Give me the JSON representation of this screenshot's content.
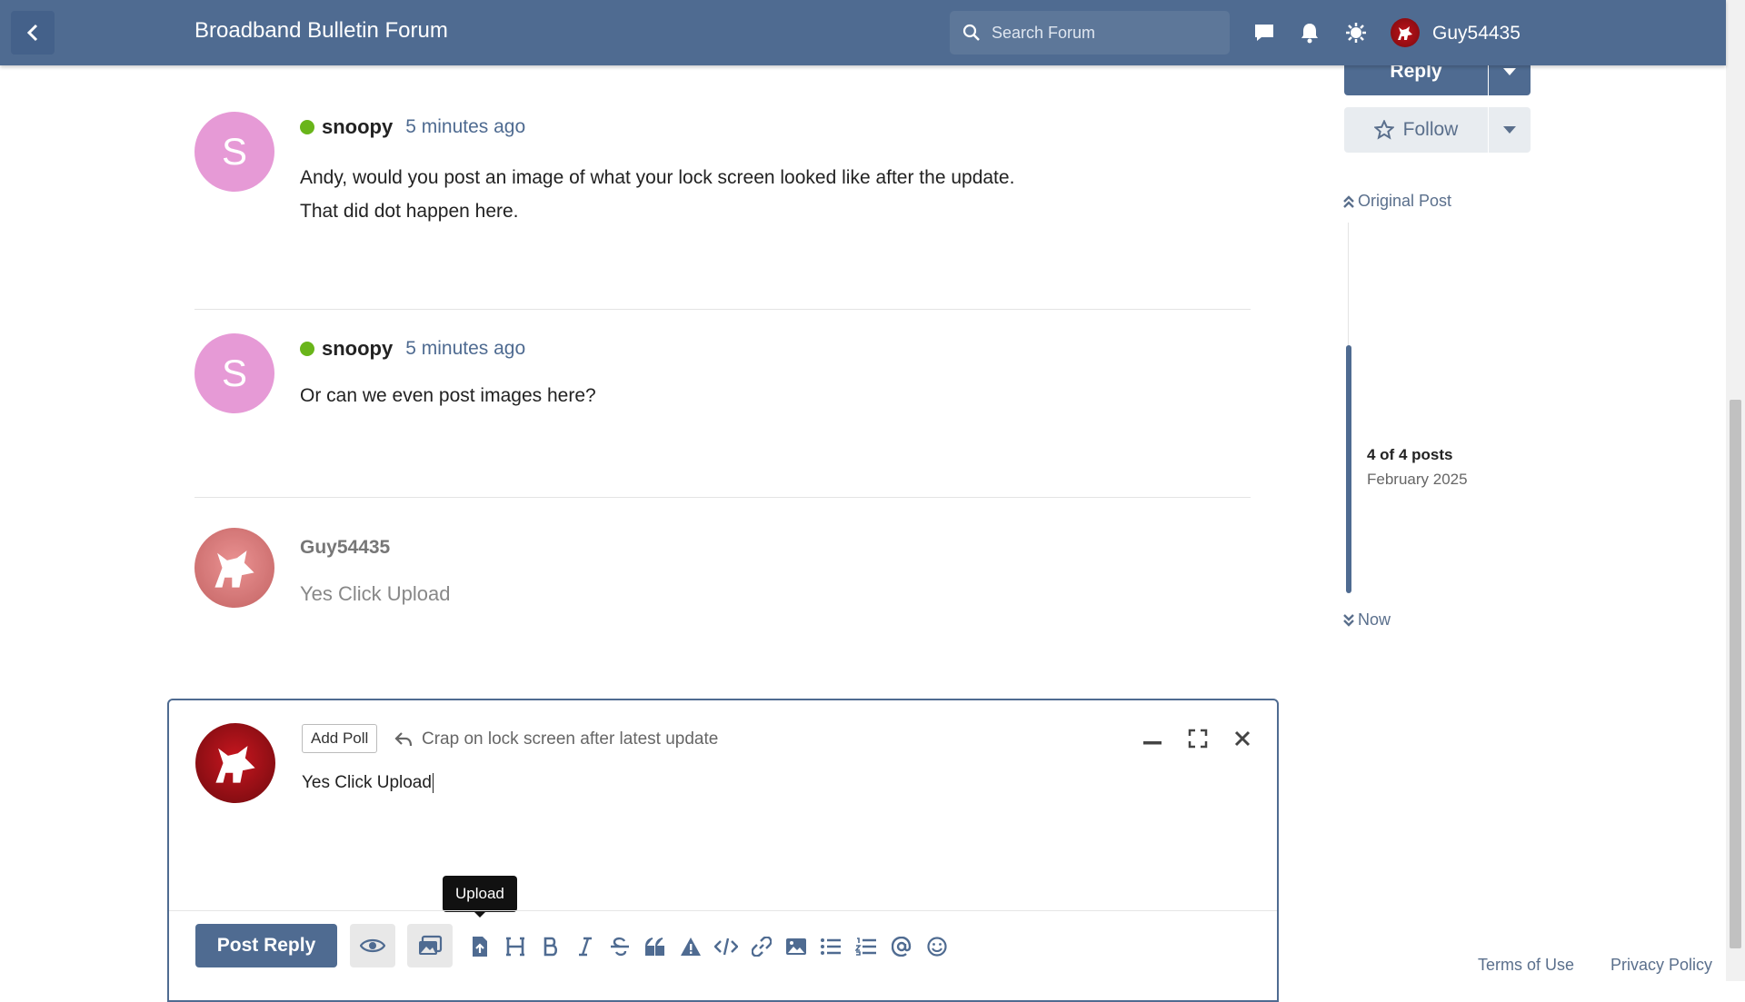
{
  "header": {
    "title": "Broadband Bulletin Forum",
    "search_placeholder": "Search Forum",
    "username": "Guy54435",
    "bg_color": "#4f6b91",
    "icons": [
      "chevron-left-icon",
      "chat-icon",
      "bell-icon",
      "theme-icon"
    ]
  },
  "posts": [
    {
      "avatar_letter": "S",
      "author": "snoopy",
      "time": "5 minutes ago",
      "lines": [
        "Andy, would you post an image of what your lock screen looked like after the update.",
        "That did dot happen here."
      ]
    },
    {
      "avatar_letter": "S",
      "author": "snoopy",
      "time": "5 minutes ago",
      "lines": [
        "Or can we even post images here?"
      ]
    }
  ],
  "draft_preview": {
    "author": "Guy54435",
    "body": "Yes Click Upload"
  },
  "composer": {
    "add_poll": "Add Poll",
    "reply_topic": "Crap on lock screen after latest update",
    "text": "Yes Click Upload",
    "tooltip": "Upload",
    "post_reply": "Post Reply",
    "toolbar_icons": [
      "preview-icon",
      "image-gallery-icon",
      "upload-icon",
      "heading-icon",
      "bold-icon",
      "italic-icon",
      "strikethrough-icon",
      "quote-icon",
      "warning-icon",
      "code-icon",
      "link-icon",
      "image-icon",
      "bullet-list-icon",
      "numbered-list-icon",
      "mention-icon",
      "emoji-icon"
    ]
  },
  "sidebar": {
    "reply": "Reply",
    "follow": "Follow",
    "original_post": "Original Post",
    "count": "4 of 4 posts",
    "date": "February 2025",
    "now": "Now"
  },
  "footer": {
    "terms": "Terms of Use",
    "privacy": "Privacy Policy"
  },
  "colors": {
    "accent": "#4f6b91",
    "online": "#69b51a",
    "avatar_pink": "#e69ad6"
  }
}
